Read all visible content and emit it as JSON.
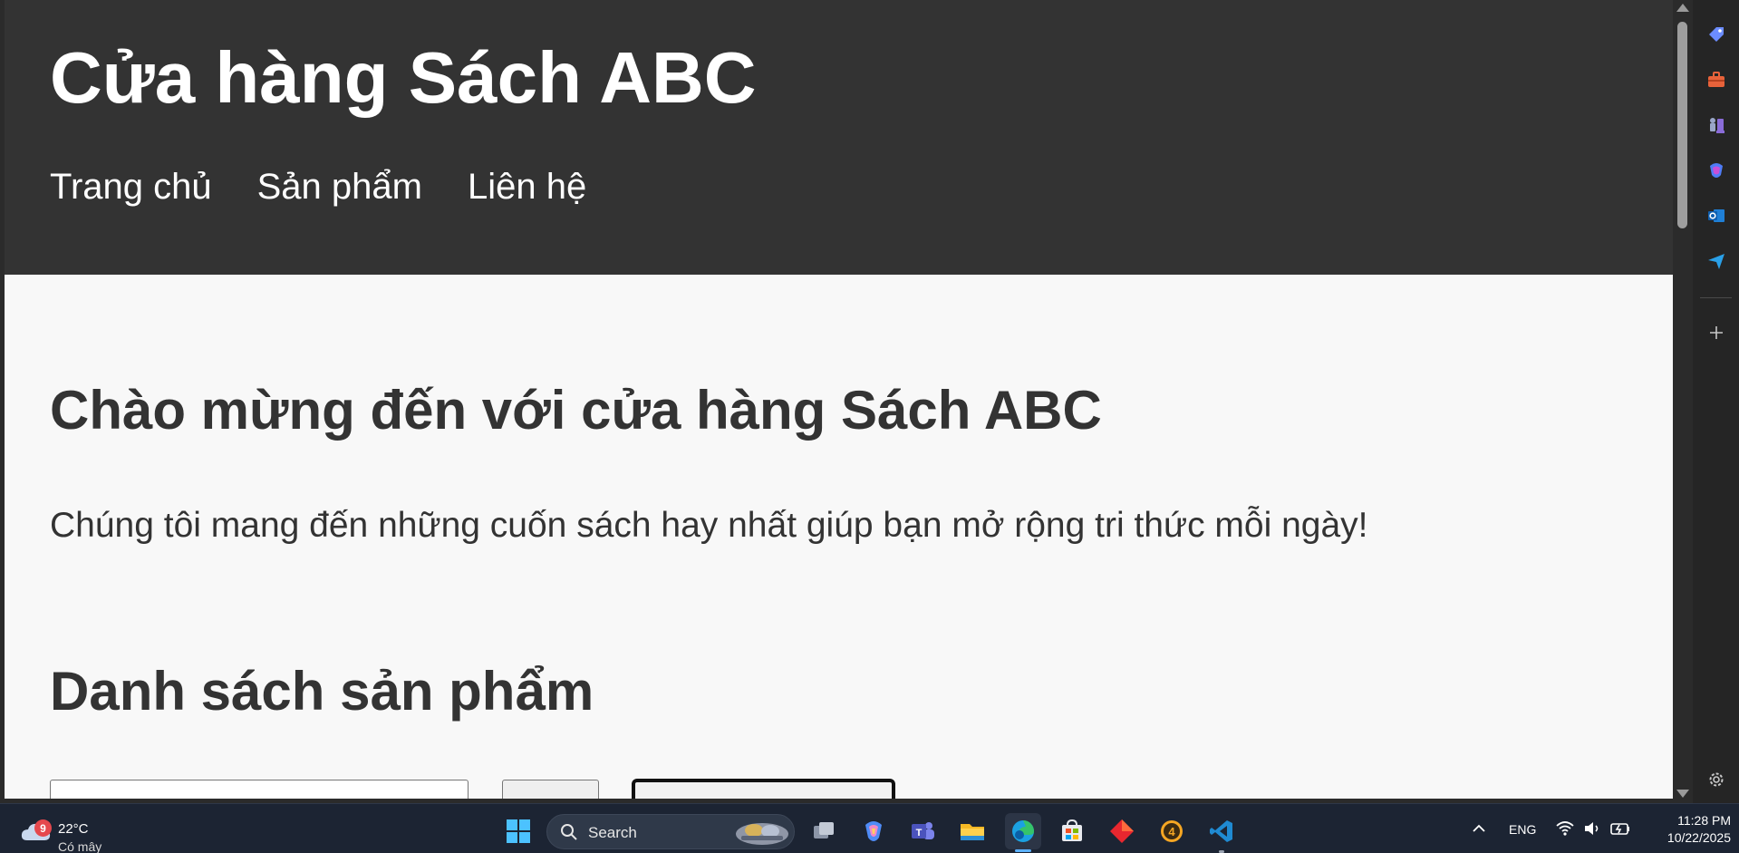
{
  "site": {
    "title": "Cửa hàng Sách ABC",
    "nav": [
      "Trang chủ",
      "Sản phẩm",
      "Liên hệ"
    ],
    "welcome_title": "Chào mừng đến với cửa hàng Sách ABC",
    "welcome_text": "Chúng tôi mang đến những cuốn sách hay nhất giúp bạn mở rộng tri thức mỗi ngày!",
    "products_title": "Danh sách sản phẩm"
  },
  "colors": {
    "header_bg": "#333333",
    "page_bg": "#f8f8f8",
    "heading_text": "#333333"
  },
  "edge_sidebar": {
    "icons": [
      "tag-icon",
      "toolbox-icon",
      "chess-icon",
      "copilot-icon",
      "outlook-icon",
      "send-icon",
      "plus-icon",
      "gear-icon"
    ]
  },
  "taskbar": {
    "weather": {
      "temp": "22°C",
      "condition": "Có mây",
      "badge": "9"
    },
    "search_label": "Search",
    "apps": [
      "windows-start-icon",
      "search-icon",
      "task-view-icon",
      "copilot-app-icon",
      "teams-icon",
      "file-explorer-icon",
      "edge-icon",
      "store-icon",
      "red-diamond-app-icon",
      "orange-4-app-icon",
      "vscode-icon"
    ],
    "tray": {
      "lang": "ENG",
      "time": "11:28 PM",
      "date": "10/22/2025"
    }
  }
}
